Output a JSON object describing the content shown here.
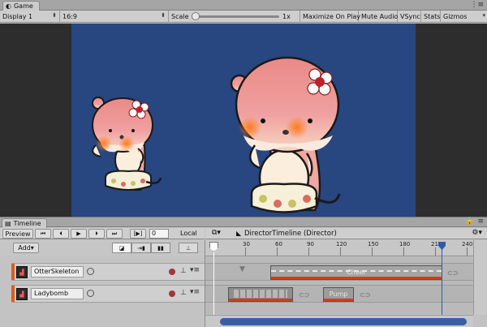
{
  "game_window": {
    "tab_title": "Game",
    "toolbar": {
      "display": "Display 1",
      "aspect": "16:9",
      "scale_label": "Scale",
      "scale_value": "1x",
      "maximize": "Maximize On Play",
      "mute": "Mute Audio",
      "vsync": "VSync",
      "stats": "Stats",
      "gizmos": "Gizmos"
    }
  },
  "timeline_window": {
    "tab_title": "Timeline",
    "preview": "Preview",
    "frame": "0",
    "space": "Local",
    "director_title": "DirectorTimeline (Director)",
    "add_label": "Add",
    "ruler_ticks": [
      "0",
      "30",
      "60",
      "90",
      "120",
      "150",
      "180",
      "210",
      "240"
    ],
    "tracks": [
      {
        "name": "OtterSkeleton",
        "clips": [
          {
            "label": "Cheer"
          }
        ]
      },
      {
        "name": "Ladybomb",
        "clips": [
          {
            "label": ""
          },
          {
            "label": "Pump"
          }
        ]
      }
    ]
  },
  "colors": {
    "scene_background": "#28467f",
    "track_accent": "#e05a1a",
    "timeline_accent": "#2f5aa8"
  },
  "icons": {
    "unity": "unity-logo-icon",
    "play": "play-icon",
    "gear": "gear-icon"
  }
}
